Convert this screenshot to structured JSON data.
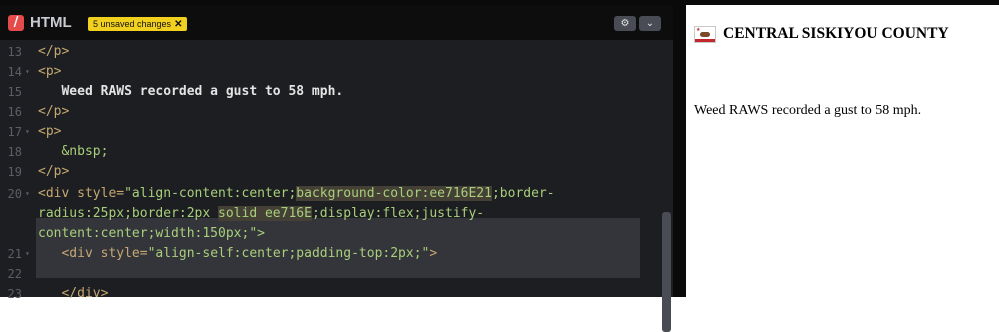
{
  "editor": {
    "title": "HTML",
    "badge_icon": "html-logo-icon",
    "unsaved_label": "5 unsaved changes",
    "close_glyph": "✕",
    "gear_glyph": "⚙",
    "chevron_glyph": "⌄"
  },
  "code_lines": [
    {
      "num": "13",
      "fold": "",
      "t1": "</p>",
      "t2": ""
    },
    {
      "num": "14",
      "fold": "▾",
      "t1": "<p>",
      "t2": ""
    },
    {
      "num": "15",
      "fold": "",
      "t1": "   Weed RAWS recorded a gust to 58 mph.",
      "t2": ""
    },
    {
      "num": "16",
      "fold": "",
      "t1": "</p>",
      "t2": ""
    },
    {
      "num": "17",
      "fold": "▾",
      "t1": "<p>",
      "t2": ""
    },
    {
      "num": "18",
      "fold": "",
      "t1": "   &nbsp;",
      "t2": ""
    },
    {
      "num": "19",
      "fold": "",
      "t1": "</p>",
      "t2": ""
    },
    {
      "num": "20",
      "fold": "▾",
      "t1": "<div",
      "t2": ""
    },
    {
      "num": "",
      "fold": "",
      "t1": "radius:25px;border:2px ",
      "t2": ""
    },
    {
      "num": "",
      "fold": "",
      "t1": "content:center;width:150px;\">",
      "t2": ""
    },
    {
      "num": "21",
      "fold": "▾",
      "t1": "   <div ",
      "t2": ""
    },
    {
      "num": "22",
      "fold": "",
      "t1": "",
      "t2": ""
    },
    {
      "num": "23",
      "fold": "",
      "t1": "   </div>",
      "t2": ""
    }
  ],
  "line20": {
    "attr": " style=",
    "str_a": "\"align-content:center;",
    "str_b": "background-color:ee716E21",
    "str_c": ";border-",
    "line2_a": "solid ee716E",
    "line2_b": ";display:flex;justify-",
    "line3": "content:center;width:150px;\">"
  },
  "line21": {
    "attr": "style=",
    "str": "\"align-self:center;padding-top:2px;\"",
    "close": ">"
  },
  "preview": {
    "flag_icon": "california-flag-icon",
    "county": "CENTRAL SISKIYOU COUNTY",
    "body": "Weed RAWS recorded a gust to 58 mph."
  },
  "colors": {
    "editor_bg": "#1d1e22",
    "tag": "#c6a872",
    "string": "#a8cf7b",
    "badge": "#f2d01e",
    "html_red": "#e54b4b"
  }
}
